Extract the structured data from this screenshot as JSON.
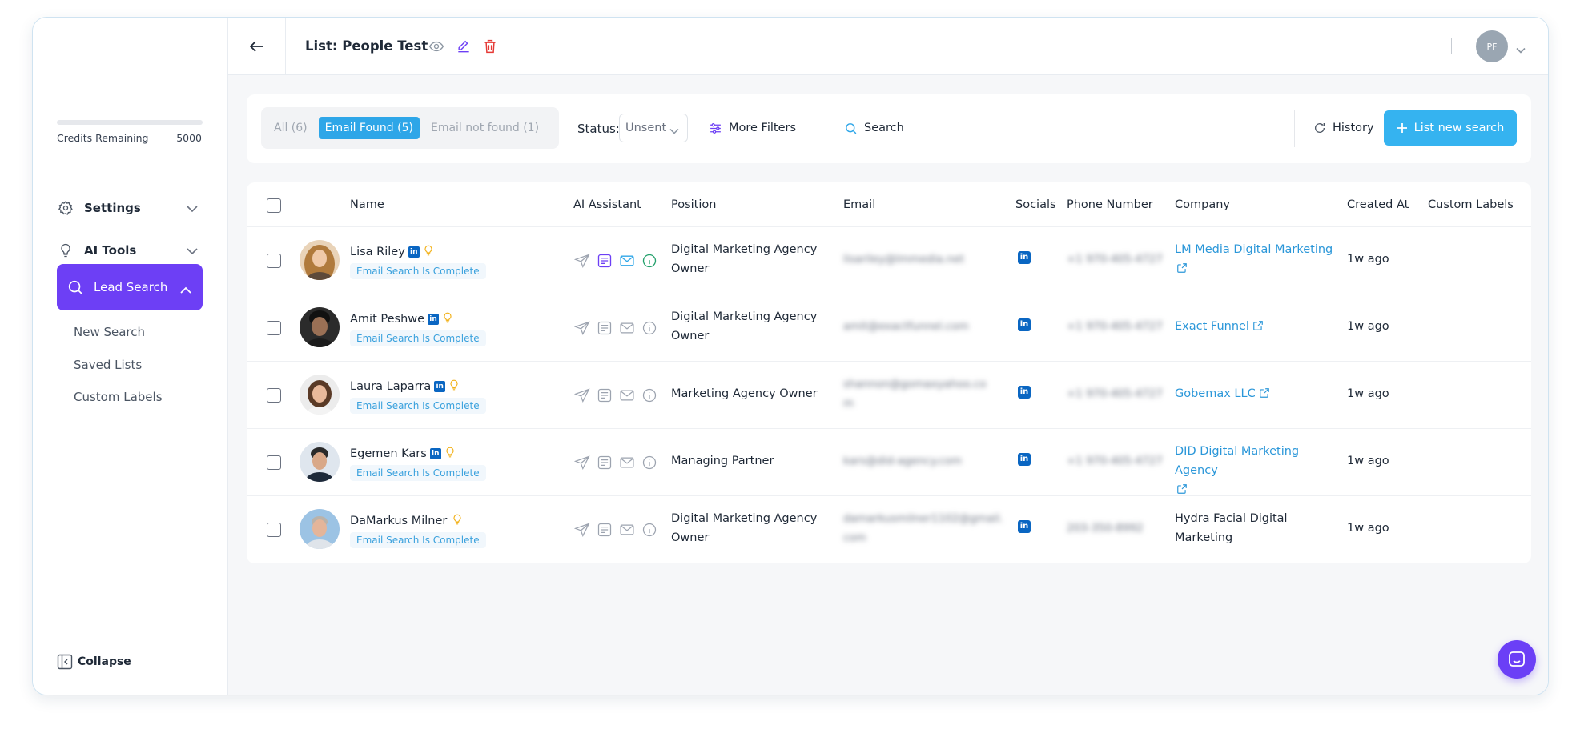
{
  "sidebar": {
    "credits_label": "Credits Remaining",
    "credits_value": "5000",
    "credits_fraction_used": 0,
    "settings_label": "Settings",
    "ai_tools_label": "AI Tools",
    "lead_search_label": "Lead Search",
    "sub_items": [
      "New Search",
      "Saved Lists",
      "Custom Labels"
    ],
    "collapse_label": "Collapse",
    "accent_color": "#6d3ff5"
  },
  "header": {
    "title": "List: People Test",
    "avatar_initials": "PF"
  },
  "filters": {
    "tabs": [
      {
        "label": "All (6)"
      },
      {
        "label": "Email Found (5)"
      },
      {
        "label": "Email not found (1)"
      }
    ],
    "active_tab": "Email Found (5)",
    "status_label": "Status:",
    "status_value": "Unsent",
    "more_filters_label": "More Filters",
    "search_label": "Search",
    "history_label": "History",
    "new_search_label": "List new search",
    "primary_color": "#35b3f0"
  },
  "table": {
    "columns": {
      "name": "Name",
      "ai": "AI Assistant",
      "position": "Position",
      "email": "Email",
      "socials": "Socials",
      "phone": "Phone Number",
      "company": "Company",
      "created": "Created At",
      "labels": "Custom Labels"
    },
    "rows": [
      {
        "name": "Lisa Riley",
        "status": "Email Search Is Complete",
        "position_1": "Digital Marketing Agency",
        "position_2": "Owner",
        "email_1": "lisariley@lmmedia.net",
        "email_2": "",
        "phone": "+1 970-405-4727",
        "company_1": "LM Media Digital Marketing",
        "company_2": "",
        "company_is_link": true,
        "created": "1w ago",
        "has_linkedin_badge": true
      },
      {
        "name": "Amit Peshwe",
        "status": "Email Search Is Complete",
        "position_1": "Digital Marketing Agency",
        "position_2": "Owner",
        "email_1": "amit@exactfunnel.com",
        "email_2": "",
        "phone": "+1 970-405-4727",
        "company_1": "Exact Funnel",
        "company_2": "",
        "company_is_link": true,
        "created": "1w ago",
        "has_linkedin_badge": true
      },
      {
        "name": "Laura Laparra",
        "status": "Email Search Is Complete",
        "position_1": "Marketing Agency Owner",
        "position_2": "",
        "email_1": "shannon@gomaxyahoo.co",
        "email_2": "m",
        "phone": "+1 970-405-4727",
        "company_1": "Gobemax LLC",
        "company_2": "",
        "company_is_link": true,
        "created": "1w ago",
        "has_linkedin_badge": true
      },
      {
        "name": "Egemen Kars",
        "status": "Email Search Is Complete",
        "position_1": "Managing Partner",
        "position_2": "",
        "email_1": "kars@did-agency.com",
        "email_2": "",
        "phone": "+1 970-405-4727",
        "company_1": "DID Digital Marketing Agency",
        "company_2": "",
        "company_is_link": true,
        "created": "1w ago",
        "has_linkedin_badge": true
      },
      {
        "name": "DaMarkus Milner",
        "status": "Email Search Is Complete",
        "position_1": "Digital Marketing Agency",
        "position_2": "Owner",
        "email_1": "damarkusmilner1102@gmail.",
        "email_2": "com",
        "phone": "203-350-8992",
        "company_1": "Hydra Facial Digital",
        "company_2": "Marketing",
        "company_is_link": false,
        "created": "1w ago",
        "has_linkedin_badge": false
      }
    ]
  }
}
